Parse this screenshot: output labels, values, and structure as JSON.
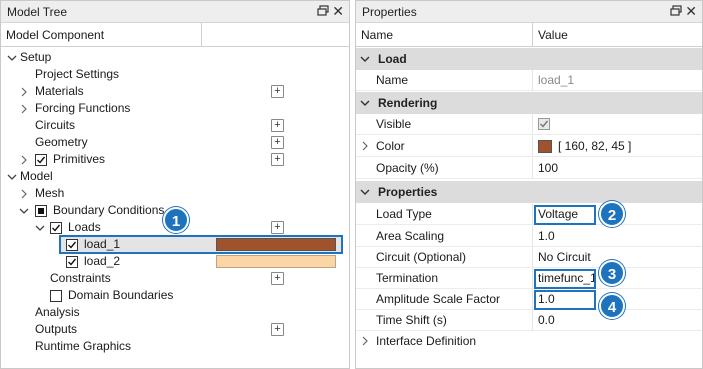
{
  "tree_panel": {
    "title": "Model Tree",
    "column_header": "Model Component",
    "items": [
      {
        "label": "Setup"
      },
      {
        "label": "Project Settings"
      },
      {
        "label": "Materials"
      },
      {
        "label": "Forcing Functions"
      },
      {
        "label": "Circuits"
      },
      {
        "label": "Geometry"
      },
      {
        "label": "Primitives"
      },
      {
        "label": "Model"
      },
      {
        "label": "Mesh"
      },
      {
        "label": "Boundary Conditions"
      },
      {
        "label": "Loads"
      },
      {
        "label": "load_1",
        "color": "#a0522d"
      },
      {
        "label": "load_2",
        "color": "#fcd5a5"
      },
      {
        "label": "Constraints"
      },
      {
        "label": "Domain Boundaries"
      },
      {
        "label": "Analysis"
      },
      {
        "label": "Outputs"
      },
      {
        "label": "Runtime Graphics"
      }
    ],
    "plus_symbol": "+"
  },
  "props_panel": {
    "title": "Properties",
    "col_name": "Name",
    "col_value": "Value",
    "sections": {
      "load": "Load",
      "rendering": "Rendering",
      "properties": "Properties"
    },
    "rows": {
      "name": {
        "name": "Name",
        "value": "load_1"
      },
      "visible": {
        "name": "Visible"
      },
      "color": {
        "name": "Color",
        "value": "[ 160, 82, 45 ]",
        "swatch": "#a0522d"
      },
      "opacity": {
        "name": "Opacity (%)",
        "value": "100"
      },
      "load_type": {
        "name": "Load Type",
        "value": "Voltage"
      },
      "area_scaling": {
        "name": "Area Scaling",
        "value": "1.0"
      },
      "circuit": {
        "name": "Circuit (Optional)",
        "value": "No Circuit"
      },
      "termination": {
        "name": "Termination",
        "value": "timefunc_1"
      },
      "amplitude": {
        "name": "Amplitude Scale Factor",
        "value": "1.0"
      },
      "time_shift": {
        "name": "Time Shift (s)",
        "value": "0.0"
      },
      "interface": {
        "name": "Interface Definition"
      }
    }
  },
  "callouts": [
    "1",
    "2",
    "3",
    "4"
  ],
  "colors": {
    "accent": "#1e73be",
    "section_bg": "#dcdcdc"
  }
}
